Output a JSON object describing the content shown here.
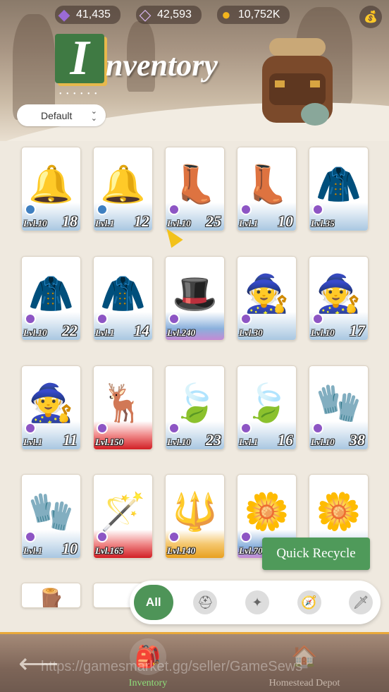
{
  "currencies": [
    {
      "icon": "purple-crystal-icon",
      "value": "41,435",
      "color": "#9b6bd6"
    },
    {
      "icon": "diamond-icon",
      "value": "42,593",
      "color": "#d7b6f0"
    },
    {
      "icon": "gold-coin-icon",
      "value": "10,752K",
      "color": "#f2b51d"
    }
  ],
  "title": {
    "cap": "I",
    "rest": "nventory"
  },
  "sort": {
    "selected": "Default"
  },
  "items": [
    {
      "name": "golden-bell",
      "art": "🔔",
      "lvl": "Lvl.10",
      "qty": "18",
      "rarity": "common",
      "badge": "blue"
    },
    {
      "name": "golden-bell",
      "art": "🔔",
      "lvl": "Lvl.1",
      "qty": "12",
      "rarity": "common",
      "badge": "blue"
    },
    {
      "name": "leather-boots",
      "art": "👢",
      "lvl": "Lvl.10",
      "qty": "25",
      "rarity": "common",
      "badge": "purple"
    },
    {
      "name": "leather-boots",
      "art": "👢",
      "lvl": "Lvl.1",
      "qty": "10",
      "rarity": "common",
      "badge": "purple"
    },
    {
      "name": "traveler-coat",
      "art": "🧥",
      "lvl": "Lvl.35",
      "qty": "",
      "rarity": "common",
      "badge": "purple"
    },
    {
      "name": "traveler-coat",
      "art": "🧥",
      "lvl": "Lvl.10",
      "qty": "22",
      "rarity": "common",
      "badge": "purple"
    },
    {
      "name": "traveler-coat",
      "art": "🧥",
      "lvl": "Lvl.1",
      "qty": "14",
      "rarity": "common",
      "badge": "purple"
    },
    {
      "name": "grape-hat",
      "art": "🎩",
      "lvl": "Lvl.240",
      "qty": "",
      "rarity": "rare",
      "badge": "purple"
    },
    {
      "name": "witch-hat",
      "art": "🧙",
      "lvl": "Lvl.30",
      "qty": "",
      "rarity": "common",
      "badge": "purple"
    },
    {
      "name": "witch-hat",
      "art": "🧙",
      "lvl": "Lvl.10",
      "qty": "17",
      "rarity": "common",
      "badge": "purple"
    },
    {
      "name": "witch-hat",
      "art": "🧙",
      "lvl": "Lvl.1",
      "qty": "11",
      "rarity": "common",
      "badge": "purple"
    },
    {
      "name": "antler-crown",
      "art": "🦌",
      "lvl": "Lvl.150",
      "qty": "",
      "rarity": "red",
      "badge": "purple"
    },
    {
      "name": "leaf-charm",
      "art": "🍃",
      "lvl": "Lvl.10",
      "qty": "23",
      "rarity": "common",
      "badge": "purple"
    },
    {
      "name": "leaf-charm",
      "art": "🍃",
      "lvl": "Lvl.1",
      "qty": "16",
      "rarity": "common",
      "badge": "purple"
    },
    {
      "name": "leather-glove",
      "art": "🧤",
      "lvl": "Lvl.10",
      "qty": "38",
      "rarity": "common",
      "badge": "purple"
    },
    {
      "name": "leather-glove",
      "art": "🧤",
      "lvl": "Lvl.1",
      "qty": "10",
      "rarity": "common",
      "badge": "purple"
    },
    {
      "name": "feather-staff",
      "art": "🪄",
      "lvl": "Lvl.165",
      "qty": "",
      "rarity": "red",
      "badge": "purple"
    },
    {
      "name": "crystal-staff",
      "art": "🔱",
      "lvl": "Lvl.140",
      "qty": "",
      "rarity": "gold",
      "badge": "purple"
    },
    {
      "name": "flower-branch",
      "art": "🌼",
      "lvl": "Lvl.70",
      "qty": "",
      "rarity": "rare",
      "badge": "purple"
    },
    {
      "name": "flower-branch",
      "art": "🌼",
      "lvl": "",
      "qty": "",
      "rarity": "common",
      "badge": ""
    },
    {
      "name": "partial-item",
      "art": "🪵",
      "lvl": "",
      "qty": "",
      "rarity": "none",
      "badge": ""
    },
    {
      "name": "partial-item",
      "art": "",
      "lvl": "",
      "qty": "",
      "rarity": "none",
      "badge": ""
    }
  ],
  "quick_recycle": "Quick Recycle",
  "filters": [
    {
      "label": "All",
      "icon": "all-filter"
    },
    {
      "label": "",
      "icon": "helmet-icon",
      "glyph": "⛑"
    },
    {
      "label": "",
      "icon": "compass-star-icon",
      "glyph": "✦"
    },
    {
      "label": "",
      "icon": "compass-icon",
      "glyph": "🧭"
    },
    {
      "label": "",
      "icon": "sword-shield-icon",
      "glyph": "🗡"
    }
  ],
  "nav": {
    "back_glyph": "⟵",
    "tabs": [
      {
        "label": "Inventory",
        "icon": "backpack-icon",
        "glyph": "🎒"
      },
      {
        "label": "Homestead Depot",
        "icon": "house-icon",
        "glyph": "🏠"
      }
    ]
  },
  "watermark": "https://gamesmarket.gg/seller/GameSews"
}
